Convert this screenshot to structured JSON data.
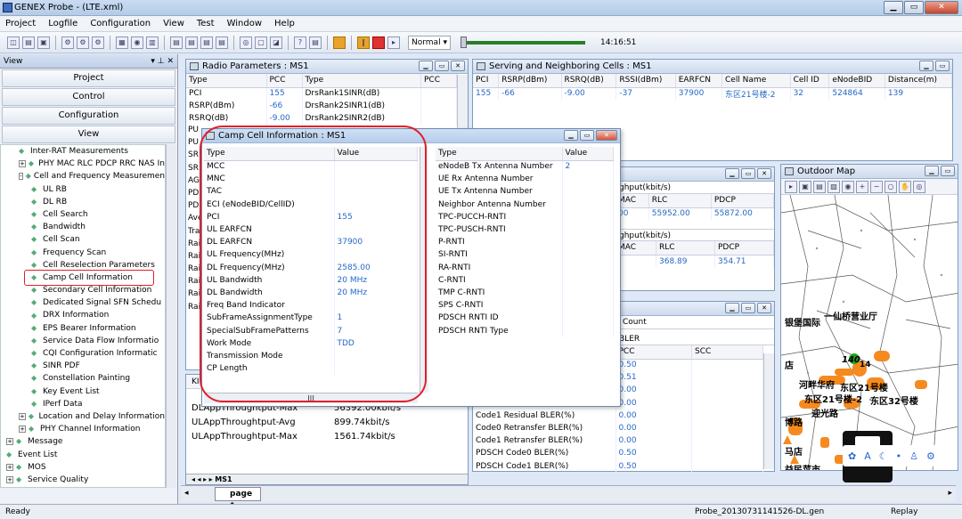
{
  "app": {
    "title": "GENEX Probe - (LTE.xml)"
  },
  "menu": [
    "Project",
    "Logfile",
    "Configuration",
    "View",
    "Test",
    "Window",
    "Help"
  ],
  "toolbar": {
    "speed": "Normal",
    "time": "14:16:51"
  },
  "view": {
    "title": "View",
    "nav": [
      "Project",
      "Control",
      "Configuration",
      "View"
    ]
  },
  "tree": [
    {
      "label": "Inter-RAT Measurements",
      "lvl": 1,
      "pm": ""
    },
    {
      "label": "PHY MAC RLC PDCP RRC NAS In",
      "lvl": 1,
      "pm": "+"
    },
    {
      "label": "Cell and Frequency Measuremen",
      "lvl": 1,
      "pm": "-"
    },
    {
      "label": "UL RB",
      "lvl": 2,
      "pm": ""
    },
    {
      "label": "DL RB",
      "lvl": 2,
      "pm": ""
    },
    {
      "label": "Cell Search",
      "lvl": 2,
      "pm": ""
    },
    {
      "label": "Bandwidth",
      "lvl": 2,
      "pm": ""
    },
    {
      "label": "Cell Scan",
      "lvl": 2,
      "pm": ""
    },
    {
      "label": "Frequency Scan",
      "lvl": 2,
      "pm": ""
    },
    {
      "label": "Cell Reselection Parameters",
      "lvl": 2,
      "pm": ""
    },
    {
      "label": "Camp Cell Information",
      "lvl": 2,
      "pm": ""
    },
    {
      "label": "Secondary Cell Information",
      "lvl": 2,
      "pm": ""
    },
    {
      "label": "Dedicated Signal SFN Schedu",
      "lvl": 2,
      "pm": ""
    },
    {
      "label": "DRX Information",
      "lvl": 2,
      "pm": ""
    },
    {
      "label": "EPS Bearer Information",
      "lvl": 2,
      "pm": ""
    },
    {
      "label": "Service Data Flow Informatio",
      "lvl": 2,
      "pm": ""
    },
    {
      "label": "CQI Configuration Informatic",
      "lvl": 2,
      "pm": ""
    },
    {
      "label": "SINR PDF",
      "lvl": 2,
      "pm": ""
    },
    {
      "label": "Constellation Painting",
      "lvl": 2,
      "pm": ""
    },
    {
      "label": "Key Event List",
      "lvl": 2,
      "pm": ""
    },
    {
      "label": "IPerf Data",
      "lvl": 2,
      "pm": ""
    },
    {
      "label": "Location and Delay Information",
      "lvl": 1,
      "pm": "+"
    },
    {
      "label": "PHY Channel Information",
      "lvl": 1,
      "pm": "+"
    },
    {
      "label": "Message",
      "lvl": 0,
      "pm": "+"
    },
    {
      "label": "Event List",
      "lvl": 0,
      "pm": ""
    },
    {
      "label": "MOS",
      "lvl": 0,
      "pm": "+"
    },
    {
      "label": "Service Quality",
      "lvl": 0,
      "pm": "+"
    }
  ],
  "radio": {
    "title": "Radio Parameters : MS1",
    "cols": [
      "Type",
      "PCC",
      "Type",
      "PCC"
    ],
    "rows": [
      [
        "PCI",
        "155",
        "DrsRank1SINR(dB)",
        ""
      ],
      [
        "RSRP(dBm)",
        "-66",
        "DrsRank2SINR1(dB)",
        ""
      ],
      [
        "RSRQ(dB)",
        "-9.00",
        "DrsRank2SINR2(dB)",
        ""
      ]
    ],
    "leftcol": [
      "PU",
      "PU",
      "SR",
      "SR",
      "AG",
      "PD",
      "PD",
      "Ave",
      "Tra",
      "Rai",
      "Rai",
      "Rai",
      "Rai",
      "Rai",
      "Rai"
    ]
  },
  "kpi": {
    "header": "KI",
    "rows": [
      [
        "DLAppThroughtput-Max",
        "56392.00kbit/s"
      ],
      [
        "ULAppThroughtput-Avg",
        "899.74kbit/s"
      ],
      [
        "ULAppThroughtput-Max",
        "1561.74kbit/s"
      ]
    ],
    "tab": "MS1"
  },
  "serving": {
    "title": "Serving and Neighboring Cells : MS1",
    "cols": [
      "PCI",
      "RSRP(dBm)",
      "RSRQ(dB)",
      "RSSI(dBm)",
      "EARFCN",
      "Cell Name",
      "Cell ID",
      "eNodeBID",
      "Distance(m)"
    ],
    "rows": [
      [
        "155",
        "-66",
        "-9.00",
        "-37",
        "37900",
        "东区21号楼-2",
        "32",
        "524864",
        "139"
      ]
    ]
  },
  "throughput": {
    "t1": "ghput(kbit/s)",
    "cols": [
      "MAC",
      "RLC",
      "PDCP"
    ],
    "r1": [
      "00",
      "55952.00",
      "55872.00"
    ],
    "t2": "ghput(kbit/s)",
    "r2": [
      "",
      "368.89",
      "354.71"
    ]
  },
  "bler": {
    "count": "Count",
    "bler": "BLER",
    "cols": [
      "PCC",
      "SCC"
    ],
    "rows": [
      [
        "",
        "0.50"
      ],
      [
        "",
        "0.51"
      ],
      [
        "",
        "0.00"
      ],
      [
        "",
        "0.00"
      ],
      [
        "Code1 Residual BLER(%)",
        "0.00"
      ],
      [
        "Code0 Retransfer BLER(%)",
        "0.00"
      ],
      [
        "Code1 Retransfer BLER(%)",
        "0.00"
      ],
      [
        "PDSCH Code0 BLER(%)",
        "0.50"
      ],
      [
        "PDSCH Code1 BLER(%)",
        "0.50"
      ]
    ]
  },
  "camp": {
    "title": "Camp Cell Information : MS1",
    "cols": [
      "Type",
      "Value",
      "Type",
      "Value"
    ],
    "left": [
      [
        "MCC",
        ""
      ],
      [
        "MNC",
        ""
      ],
      [
        "TAC",
        ""
      ],
      [
        "ECI (eNodeBID/CellID)",
        ""
      ],
      [
        "PCI",
        "155"
      ],
      [
        "UL EARFCN",
        ""
      ],
      [
        "DL EARFCN",
        "37900"
      ],
      [
        "UL Frequency(MHz)",
        ""
      ],
      [
        "DL Frequency(MHz)",
        "2585.00"
      ],
      [
        "UL Bandwidth",
        "20 MHz"
      ],
      [
        "DL Bandwidth",
        "20 MHz"
      ],
      [
        "Freq Band Indicator",
        ""
      ],
      [
        "SubFrameAssignmentType",
        "1"
      ],
      [
        "SpecialSubFramePatterns",
        "7"
      ],
      [
        "Work Mode",
        "TDD"
      ],
      [
        "Transmission Mode",
        ""
      ],
      [
        "CP Length",
        ""
      ]
    ],
    "right": [
      [
        "eNodeB Tx Antenna Number",
        "2"
      ],
      [
        "UE Rx Antenna Number",
        ""
      ],
      [
        "UE Tx Antenna Number",
        ""
      ],
      [
        "Neighbor Antenna Number",
        ""
      ],
      [
        "TPC-PUCCH-RNTI",
        ""
      ],
      [
        "TPC-PUSCH-RNTI",
        ""
      ],
      [
        "P-RNTI",
        ""
      ],
      [
        "SI-RNTI",
        ""
      ],
      [
        "RA-RNTI",
        ""
      ],
      [
        "C-RNTI",
        ""
      ],
      [
        "TMP C-RNTI",
        ""
      ],
      [
        "SPS C-RNTI",
        ""
      ],
      [
        "PDSCH RNTI ID",
        ""
      ],
      [
        "PDSCH RNTI Type",
        ""
      ]
    ]
  },
  "map": {
    "title": "Outdoor Map",
    "labels": [
      "一仙桥营业厅",
      "银堡国际",
      "店",
      "河畔华府",
      "东区21号楼",
      "东区21号楼-2",
      "东区32号楼",
      "迎光路",
      "博路",
      "马店",
      "益民菜市",
      "140",
      "14"
    ]
  },
  "page": {
    "tab": "page 1"
  },
  "status": {
    "left": "Ready",
    "file": "Probe_20130731141526-DL.gen",
    "mode": "Replay"
  }
}
